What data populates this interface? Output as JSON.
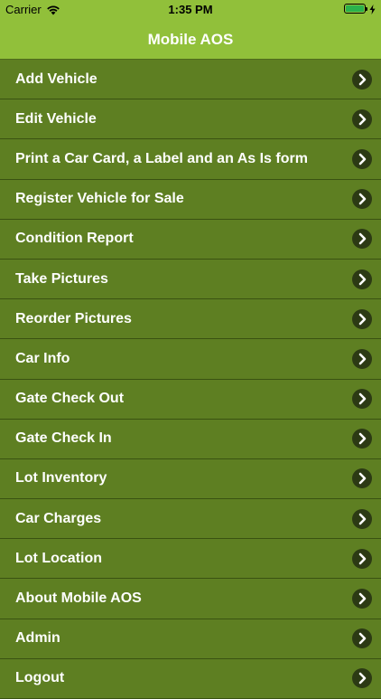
{
  "status_bar": {
    "carrier": "Carrier",
    "time": "1:35 PM"
  },
  "nav": {
    "title": "Mobile AOS"
  },
  "menu": {
    "items": [
      {
        "label": "Add Vehicle",
        "icon": "chevron-right-icon"
      },
      {
        "label": "Edit Vehicle",
        "icon": "chevron-right-icon"
      },
      {
        "label": "Print a Car Card, a Label and an As Is form",
        "icon": "chevron-right-icon"
      },
      {
        "label": "Register Vehicle for Sale",
        "icon": "chevron-right-icon"
      },
      {
        "label": "Condition Report",
        "icon": "chevron-right-icon"
      },
      {
        "label": "Take Pictures",
        "icon": "chevron-right-icon"
      },
      {
        "label": "Reorder Pictures",
        "icon": "chevron-right-icon"
      },
      {
        "label": "Car Info",
        "icon": "chevron-right-icon"
      },
      {
        "label": "Gate Check Out",
        "icon": "chevron-right-icon"
      },
      {
        "label": "Gate Check In",
        "icon": "chevron-right-icon"
      },
      {
        "label": "Lot Inventory",
        "icon": "chevron-right-icon"
      },
      {
        "label": "Car Charges",
        "icon": "chevron-right-icon"
      },
      {
        "label": "Lot Location",
        "icon": "chevron-right-icon"
      },
      {
        "label": "About Mobile AOS",
        "icon": "chevron-right-icon"
      },
      {
        "label": "Admin",
        "icon": "chevron-right-icon"
      },
      {
        "label": "Logout",
        "icon": "chevron-right-icon"
      }
    ]
  },
  "colors": {
    "header_green": "#91c03a",
    "row_green": "#5e7f22",
    "chevron_dark": "#2c3a14"
  }
}
